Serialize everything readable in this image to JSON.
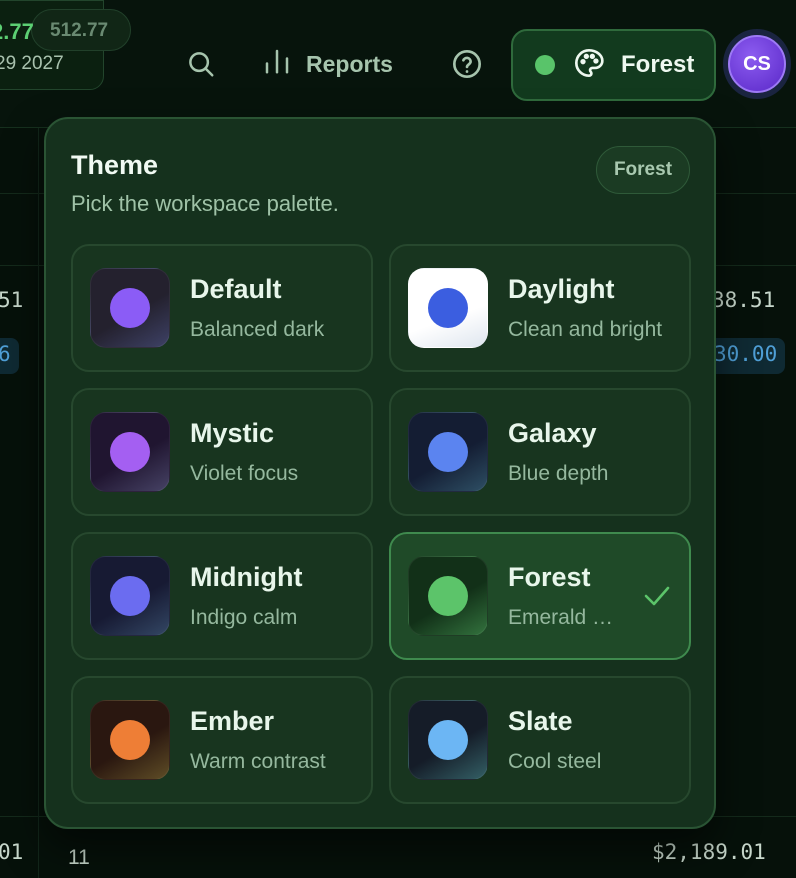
{
  "background": {
    "ticker": {
      "ghost_value": "512.77",
      "value": "2.77",
      "date": "29 2027"
    },
    "rows": [
      {
        "left": "51",
        "right": "38.51"
      },
      {
        "left_pill": "6",
        "right_pill": "30.00"
      }
    ],
    "footer": {
      "left": "01",
      "middle": "11",
      "right": "$2,189.01"
    }
  },
  "header": {
    "search_icon": "search-icon",
    "reports_label": "Reports",
    "reports_icon": "bar-chart-icon",
    "help_icon": "help-circle-icon",
    "theme_trigger": {
      "label": "Forest",
      "dot_color": "#59c46a",
      "icon": "palette-icon"
    },
    "avatar_initials": "CS"
  },
  "theme_popover": {
    "title": "Theme",
    "subtitle": "Pick the workspace palette.",
    "current_badge": "Forest",
    "themes": [
      {
        "name": "Default",
        "description": "Balanced dark",
        "swatch_bg": "#24212e",
        "dot_color": "#8b5cf6",
        "selected": false
      },
      {
        "name": "Daylight",
        "description": "Clean and bright",
        "swatch_bg": "#ffffff",
        "dot_color": "#3b5ee0",
        "selected": false
      },
      {
        "name": "Mystic",
        "description": "Violet focus",
        "swatch_bg": "#201530",
        "dot_color": "#a45ff2",
        "selected": false
      },
      {
        "name": "Galaxy",
        "description": "Blue depth",
        "swatch_bg": "#141d33",
        "dot_color": "#5b84f0",
        "selected": false
      },
      {
        "name": "Midnight",
        "description": "Indigo calm",
        "swatch_bg": "#171a33",
        "dot_color": "#6b6cf0",
        "selected": false
      },
      {
        "name": "Forest",
        "description": "Emerald canopy",
        "swatch_bg": "#123018",
        "dot_color": "#5cc46a",
        "selected": true
      },
      {
        "name": "Ember",
        "description": "Warm contrast",
        "swatch_bg": "#2a1710",
        "dot_color": "#ee7e36",
        "selected": false
      },
      {
        "name": "Slate",
        "description": "Cool steel",
        "swatch_bg": "#151c28",
        "dot_color": "#6cb6f4",
        "selected": false
      }
    ]
  },
  "colors": {
    "accent": "#59c46a",
    "popover_bg": "#15311d",
    "selected_border": "#3f8a4e"
  }
}
